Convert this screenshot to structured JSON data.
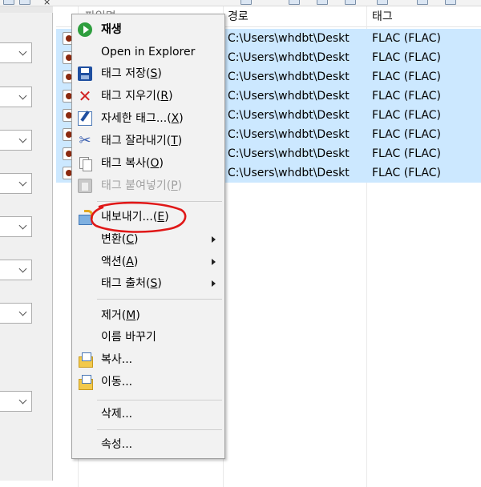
{
  "toolbar": {
    "close_glyph": "×"
  },
  "columns": [
    {
      "label": "파일명"
    },
    {
      "label": "경로"
    },
    {
      "label": "태그"
    }
  ],
  "rows": [
    {
      "path": "C:\\Users\\whdbt\\Deskt",
      "tag": "FLAC (FLAC)"
    },
    {
      "path": "C:\\Users\\whdbt\\Deskt",
      "tag": "FLAC (FLAC)"
    },
    {
      "path": "C:\\Users\\whdbt\\Deskt",
      "tag": "FLAC (FLAC)"
    },
    {
      "path": "C:\\Users\\whdbt\\Deskt",
      "tag": "FLAC (FLAC)"
    },
    {
      "path": "C:\\Users\\whdbt\\Deskt",
      "tag": "FLAC (FLAC)"
    },
    {
      "path": "C:\\Users\\whdbt\\Deskt",
      "tag": "FLAC (FLAC)"
    },
    {
      "path": "C:\\Users\\whdbt\\Deskt",
      "tag": "FLAC (FLAC)"
    },
    {
      "path": "C:\\Users\\whdbt\\Deskt",
      "tag": "FLAC (FLAC)"
    }
  ],
  "menu": {
    "play": {
      "label": "재생",
      "icon": "play-icon"
    },
    "open_explorer": {
      "label": "Open in Explorer"
    },
    "save_tag": {
      "label": "태그 저장",
      "key": "S",
      "icon": "save-icon"
    },
    "remove_tag": {
      "label": "태그 지우기",
      "key": "R",
      "icon": "delete-x-icon"
    },
    "extended_tags": {
      "label": "자세한 태그...",
      "key": "X",
      "icon": "edit-tag-icon"
    },
    "cut_tag": {
      "label": "태그 잘라내기",
      "key": "T",
      "icon": "scissors-icon"
    },
    "copy_tag": {
      "label": "태그 복사",
      "key": "O",
      "icon": "copy-icon"
    },
    "paste_tag": {
      "label": "태그 붙여넣기",
      "key": "P",
      "icon": "clipboard-icon",
      "disabled": true
    },
    "export": {
      "label": "내보내기...",
      "key": "E",
      "icon": "export-icon"
    },
    "convert": {
      "label": "변환",
      "key": "C"
    },
    "actions": {
      "label": "액션",
      "key": "A"
    },
    "tag_sources": {
      "label": "태그 출처",
      "key": "S"
    },
    "remove": {
      "label": "제거",
      "key": "M"
    },
    "rename": {
      "label": "이름 바꾸기"
    },
    "copy": {
      "label": "복사...",
      "icon": "folder-copy-icon"
    },
    "move": {
      "label": "이동...",
      "icon": "folder-move-icon"
    },
    "delete": {
      "label": "삭제..."
    },
    "properties": {
      "label": "속성..."
    }
  },
  "colors": {
    "selection": "#cce8ff",
    "annotation": "#e01818",
    "menu_bg": "#f2f2f2"
  }
}
